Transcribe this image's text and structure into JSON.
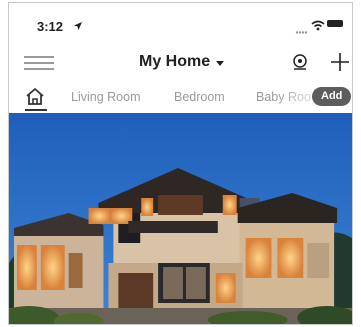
{
  "status_bar": {
    "time": "3:12"
  },
  "header": {
    "title": "My Home"
  },
  "tabs": [
    {
      "label": "Living Room"
    },
    {
      "label": "Bedroom"
    },
    {
      "label": "Baby Roo"
    }
  ],
  "add_button": {
    "label": "Add"
  },
  "icons": {
    "menu": "menu-icon",
    "location": "location-arrow-icon",
    "signal": "signal-icon",
    "wifi": "wifi-icon",
    "battery": "battery-icon",
    "camera": "camera-icon",
    "plus": "plus-icon",
    "home_tab": "home-icon"
  },
  "colors": {
    "sky": "#2c6fc4",
    "add_pill": "#5d5d5d",
    "tab_text": "#9a9a9a"
  }
}
